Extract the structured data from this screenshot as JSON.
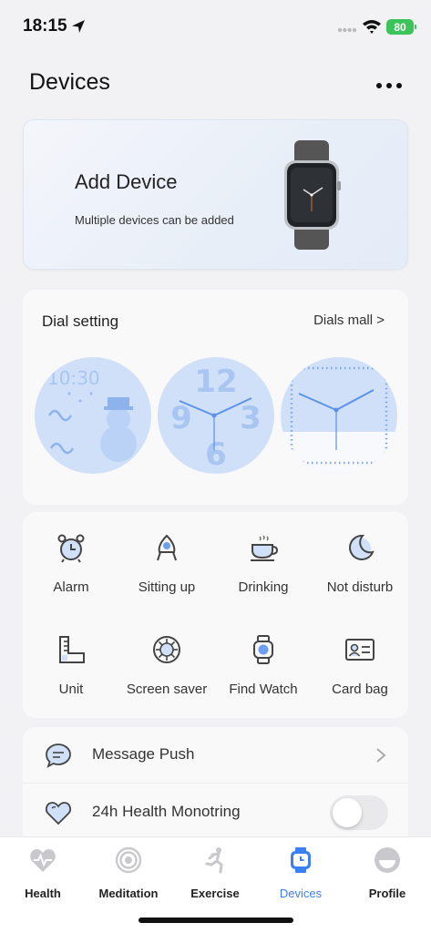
{
  "status_bar": {
    "time": "18:15",
    "battery": "80",
    "icons": [
      "location-arrow-icon",
      "signal-icon",
      "wifi-icon",
      "battery-icon"
    ]
  },
  "header": {
    "title": "Devices",
    "more_icon": "more-dots-icon"
  },
  "add_device": {
    "title": "Add Device",
    "subtitle": "Multiple devices can be added",
    "image": "smartwatch-image"
  },
  "dial_setting": {
    "title": "Dial setting",
    "mall_link": "Dials mall >",
    "dials": [
      {
        "name": "dial-snowman",
        "time_text": "10:30"
      },
      {
        "name": "dial-big-numbers",
        "numbers": [
          "12",
          "9",
          "3",
          "6"
        ]
      },
      {
        "name": "dial-analog"
      }
    ]
  },
  "features": [
    {
      "label": "Alarm",
      "icon": "alarm-clock-icon"
    },
    {
      "label": "Sitting up",
      "icon": "sitting-up-icon"
    },
    {
      "label": "Drinking",
      "icon": "coffee-cup-icon"
    },
    {
      "label": "Not disturb",
      "icon": "moon-icon"
    },
    {
      "label": "Unit",
      "icon": "ruler-icon"
    },
    {
      "label": "Screen saver",
      "icon": "screen-saver-icon"
    },
    {
      "label": "Find Watch",
      "icon": "watch-icon"
    },
    {
      "label": "Card bag",
      "icon": "id-card-icon"
    }
  ],
  "settings_list": {
    "message_push": {
      "label": "Message Push",
      "icon": "chat-bubble-icon"
    },
    "health_monitoring": {
      "label": "24h Health Monotring",
      "icon": "heart-icon",
      "enabled": false
    }
  },
  "tab_bar": {
    "active": "Devices",
    "tabs": [
      {
        "label": "Health",
        "icon": "heart-tab-icon"
      },
      {
        "label": "Meditation",
        "icon": "meditation-icon"
      },
      {
        "label": "Exercise",
        "icon": "running-icon"
      },
      {
        "label": "Devices",
        "icon": "watch-tab-icon"
      },
      {
        "label": "Profile",
        "icon": "profile-icon"
      }
    ]
  },
  "colors": {
    "accent": "#3b7ff5",
    "dial_bg": "#cfe0f8",
    "dial_stroke": "#5c92e8",
    "battery": "#3cc45a"
  }
}
